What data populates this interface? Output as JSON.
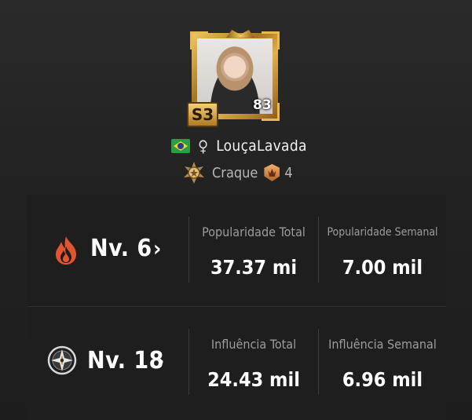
{
  "profile": {
    "season_badge": "S3",
    "level": "83",
    "name": "LouçaLavada",
    "gender_symbol": "♀",
    "country_flag": "brazil-flag-icon",
    "rank_label": "Craque",
    "tier_number": "4"
  },
  "stats": [
    {
      "icon": "flame-icon",
      "level_label": "Nv. 6",
      "chevron": "›",
      "total_label": "Popularidade Total",
      "total_value": "37.37 mi",
      "weekly_label": "Popularidade Semanal",
      "weekly_value": "7.00 mil"
    },
    {
      "icon": "compass-icon",
      "level_label": "Nv. 18",
      "chevron": "›",
      "total_label": "Influência Total",
      "total_value": "24.43 mil",
      "weekly_label": "Influência Semanal",
      "weekly_value": "6.96 mil"
    }
  ],
  "colors": {
    "background": "#222222",
    "panel": "#1e1e1e",
    "gold": "#e8b94e",
    "flame": "#e2552e",
    "label": "#9c9c9c"
  }
}
